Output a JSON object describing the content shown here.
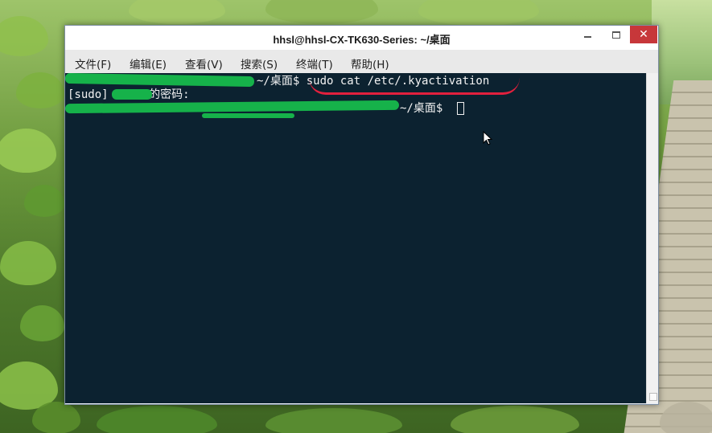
{
  "window": {
    "title": "hhsl@hhsl-CX-TK630-Series: ~/桌面"
  },
  "window_controls": {
    "minimize_icon": "minimize-icon",
    "maximize_icon": "maximize-icon",
    "close_glyph": "✕"
  },
  "menu": {
    "items": [
      {
        "label": "文件(F)"
      },
      {
        "label": "编辑(E)"
      },
      {
        "label": "查看(V)"
      },
      {
        "label": "搜索(S)"
      },
      {
        "label": "终端(T)"
      },
      {
        "label": "帮助(H)"
      }
    ]
  },
  "terminal": {
    "lines": [
      {
        "text": "~/桌面$ sudo cat /etc/.kyactivation"
      },
      {
        "text": "[sudo]      的密码:"
      },
      {
        "text": "~/桌面$"
      }
    ],
    "background": "#0c2230",
    "foreground": "#f2f2f2"
  },
  "annotations": {
    "redaction_color": "#16b24a",
    "underline_color": "#e2203d"
  }
}
